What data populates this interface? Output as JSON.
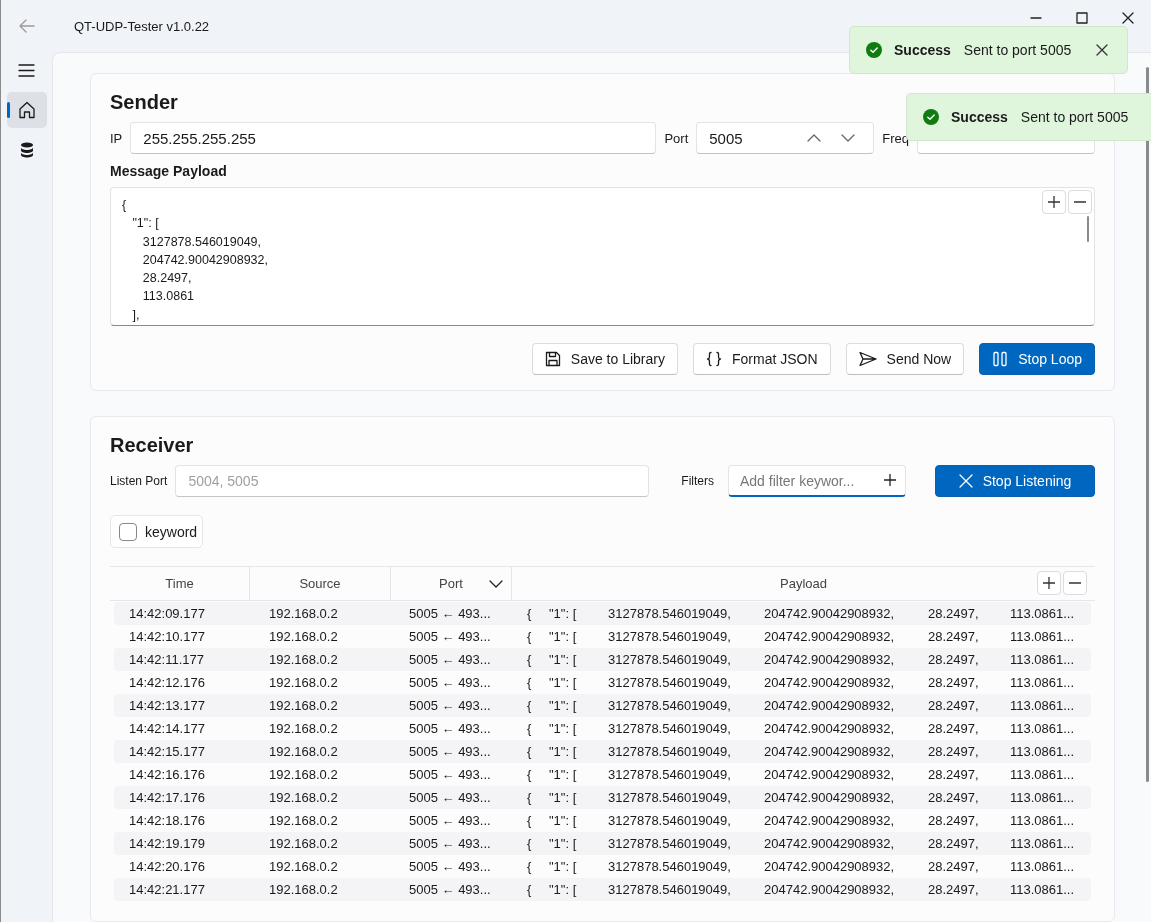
{
  "window": {
    "title": "QT-UDP-Tester v1.0.22"
  },
  "nav": [
    {
      "kind": "home",
      "selected": true
    },
    {
      "kind": "database",
      "selected": false
    }
  ],
  "toasts": [
    {
      "title": "Success",
      "message": "Sent to port 5005",
      "closable": true
    },
    {
      "title": "Success",
      "message": "Sent to port 5005",
      "closable": false
    }
  ],
  "sender": {
    "title": "Sender",
    "ip_label": "IP",
    "ip": "255.255.255.255",
    "port_label": "Port",
    "port": "5005",
    "freq_label": "Freq",
    "payload_label": "Message Payload",
    "payload": "{\n   \"1\": [\n      3127878.546019049,\n      204742.90042908932,\n      28.2497,\n      113.0861\n   ],",
    "buttons": [
      {
        "kind": "save",
        "label": "Save to Library",
        "primary": false
      },
      {
        "kind": "braces",
        "label": "Format JSON",
        "primary": false
      },
      {
        "kind": "send",
        "label": "Send Now",
        "primary": false
      },
      {
        "kind": "pause",
        "label": "Stop Loop",
        "primary": true
      }
    ]
  },
  "receiver": {
    "title": "Receiver",
    "listen_label": "Listen Port",
    "listen_placeholder": "5004, 5005",
    "filters_label": "Filters",
    "filter_placeholder": "Add filter keywor...",
    "stop_button": "Stop Listening",
    "keywords": [
      {
        "label": "keyword",
        "checked": false
      }
    ],
    "table": {
      "columns": [
        "Time",
        "Source",
        "Port",
        "Payload"
      ],
      "rows": [
        {
          "time": "14:42:09.177",
          "source": "192.168.0.2",
          "port": "5005 ← 493...",
          "payload": [
            "{",
            "\"1\": [",
            "3127878.546019049,",
            "204742.90042908932,",
            "28.2497,",
            "113.0861..."
          ]
        },
        {
          "time": "14:42:10.177",
          "source": "192.168.0.2",
          "port": "5005 ← 493...",
          "payload": [
            "{",
            "\"1\": [",
            "3127878.546019049,",
            "204742.90042908932,",
            "28.2497,",
            "113.0861..."
          ]
        },
        {
          "time": "14:42:11.177",
          "source": "192.168.0.2",
          "port": "5005 ← 493...",
          "payload": [
            "{",
            "\"1\": [",
            "3127878.546019049,",
            "204742.90042908932,",
            "28.2497,",
            "113.0861..."
          ]
        },
        {
          "time": "14:42:12.176",
          "source": "192.168.0.2",
          "port": "5005 ← 493...",
          "payload": [
            "{",
            "\"1\": [",
            "3127878.546019049,",
            "204742.90042908932,",
            "28.2497,",
            "113.0861..."
          ]
        },
        {
          "time": "14:42:13.177",
          "source": "192.168.0.2",
          "port": "5005 ← 493...",
          "payload": [
            "{",
            "\"1\": [",
            "3127878.546019049,",
            "204742.90042908932,",
            "28.2497,",
            "113.0861..."
          ]
        },
        {
          "time": "14:42:14.177",
          "source": "192.168.0.2",
          "port": "5005 ← 493...",
          "payload": [
            "{",
            "\"1\": [",
            "3127878.546019049,",
            "204742.90042908932,",
            "28.2497,",
            "113.0861..."
          ]
        },
        {
          "time": "14:42:15.177",
          "source": "192.168.0.2",
          "port": "5005 ← 493...",
          "payload": [
            "{",
            "\"1\": [",
            "3127878.546019049,",
            "204742.90042908932,",
            "28.2497,",
            "113.0861..."
          ]
        },
        {
          "time": "14:42:16.176",
          "source": "192.168.0.2",
          "port": "5005 ← 493...",
          "payload": [
            "{",
            "\"1\": [",
            "3127878.546019049,",
            "204742.90042908932,",
            "28.2497,",
            "113.0861..."
          ]
        },
        {
          "time": "14:42:17.176",
          "source": "192.168.0.2",
          "port": "5005 ← 493...",
          "payload": [
            "{",
            "\"1\": [",
            "3127878.546019049,",
            "204742.90042908932,",
            "28.2497,",
            "113.0861..."
          ]
        },
        {
          "time": "14:42:18.176",
          "source": "192.168.0.2",
          "port": "5005 ← 493...",
          "payload": [
            "{",
            "\"1\": [",
            "3127878.546019049,",
            "204742.90042908932,",
            "28.2497,",
            "113.0861..."
          ]
        },
        {
          "time": "14:42:19.179",
          "source": "192.168.0.2",
          "port": "5005 ← 493...",
          "payload": [
            "{",
            "\"1\": [",
            "3127878.546019049,",
            "204742.90042908932,",
            "28.2497,",
            "113.0861..."
          ]
        },
        {
          "time": "14:42:20.176",
          "source": "192.168.0.2",
          "port": "5005 ← 493...",
          "payload": [
            "{",
            "\"1\": [",
            "3127878.546019049,",
            "204742.90042908932,",
            "28.2497,",
            "113.0861..."
          ]
        },
        {
          "time": "14:42:21.177",
          "source": "192.168.0.2",
          "port": "5005 ← 493...",
          "payload": [
            "{",
            "\"1\": [",
            "3127878.546019049,",
            "204742.90042908932,",
            "28.2497,",
            "113.0861..."
          ]
        }
      ]
    }
  }
}
